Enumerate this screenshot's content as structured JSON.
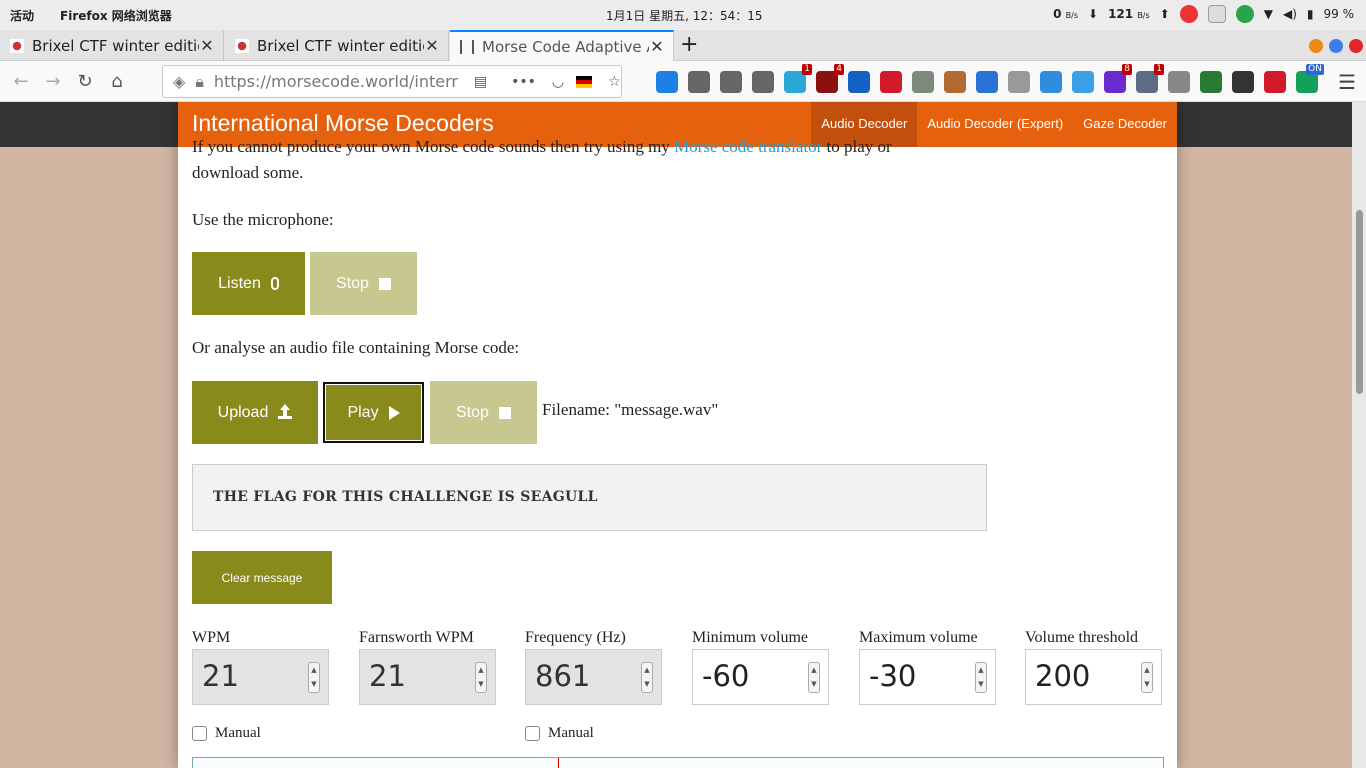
{
  "system": {
    "activities": "活动",
    "app_name": "Firefox 网络浏览器",
    "clock": "1月1日 星期五, 12：54：15",
    "net_down": "0",
    "net_up": "121",
    "net_unit": "B/s",
    "battery": "99 %"
  },
  "tabs": [
    {
      "title": "Brixel CTF winter edition",
      "close": "✕"
    },
    {
      "title": "Brixel CTF winter edition",
      "close": "✕"
    },
    {
      "title": "Morse Code Adaptive Audio Decoder",
      "close": "✕"
    }
  ],
  "new_tab": "+",
  "url": "https://morsecode.world/international/decoder/audio-decoder-adaptive.html",
  "extensions": [
    {
      "name": "download-icon",
      "color": "#1d7fe8",
      "badge": ""
    },
    {
      "name": "library-icon",
      "color": "#666666",
      "badge": ""
    },
    {
      "name": "sidebar-icon",
      "color": "#666666",
      "badge": ""
    },
    {
      "name": "account-icon",
      "color": "#666666",
      "badge": ""
    },
    {
      "name": "ghost-icon",
      "color": "#2aa8d8",
      "badge": "1"
    },
    {
      "name": "ublock-icon",
      "color": "#8b1111",
      "badge": "4"
    },
    {
      "name": "s-icon",
      "color": "#1461c6",
      "badge": ""
    },
    {
      "name": "s-red-icon",
      "color": "#d11a2a",
      "badge": ""
    },
    {
      "name": "puzzle-icon",
      "color": "#7c8a7c",
      "badge": ""
    },
    {
      "name": "cookie-icon",
      "color": "#b06a32",
      "badge": ""
    },
    {
      "name": "doc-icon",
      "color": "#2a72d6",
      "badge": ""
    },
    {
      "name": "circle-icon",
      "color": "#999999",
      "badge": ""
    },
    {
      "name": "bug-icon",
      "color": "#2f8de0",
      "badge": ""
    },
    {
      "name": "pin-icon",
      "color": "#3b9fe8",
      "badge": ""
    },
    {
      "name": "tag-icon",
      "color": "#6a2ad0",
      "badge": "8"
    },
    {
      "name": "globe-icon",
      "color": "#5b6c84",
      "badge": "1"
    },
    {
      "name": "window-icon",
      "color": "#888888",
      "badge": ""
    },
    {
      "name": "shield-icon",
      "color": "#2b7a33",
      "badge": ""
    },
    {
      "name": "bubble-icon",
      "color": "#333333",
      "badge": ""
    },
    {
      "name": "record-icon",
      "color": "#d01a2a",
      "badge": ""
    },
    {
      "name": "on-icon",
      "color": "#13a05a",
      "badge": "ON"
    }
  ],
  "site": {
    "title": "International Morse Decoders",
    "nav": [
      "Audio Decoder",
      "Audio Decoder (Expert)",
      "Gaze Decoder"
    ]
  },
  "intro": {
    "before": "If you cannot produce your own Morse code sounds then try using my ",
    "link": "Morse code translator",
    "after": " to play or download some."
  },
  "mic_label": "Use the microphone:",
  "buttons": {
    "listen": "Listen",
    "stop": "Stop",
    "upload": "Upload",
    "play": "Play",
    "stop2": "Stop",
    "clear": "Clear message"
  },
  "file_label": "Or analyse an audio file containing Morse code:",
  "filename": "Filename: \"message.wav\"",
  "decoded_message": "THE FLAG FOR THIS CHALLENGE IS SEAGULL",
  "settings": [
    {
      "label": "WPM",
      "value": "21",
      "readonly": true
    },
    {
      "label": "Farnsworth WPM",
      "value": "21",
      "readonly": true
    },
    {
      "label": "Frequency (Hz)",
      "value": "861",
      "readonly": true
    },
    {
      "label": "Minimum volume",
      "value": "-60",
      "readonly": false
    },
    {
      "label": "Maximum volume",
      "value": "-30",
      "readonly": false
    },
    {
      "label": "Volume threshold",
      "value": "200",
      "readonly": false
    }
  ],
  "manual_label": "Manual",
  "colors": {
    "brand": "#e6610e",
    "button": "#898a1c",
    "button_disabled": "#c7c790"
  }
}
